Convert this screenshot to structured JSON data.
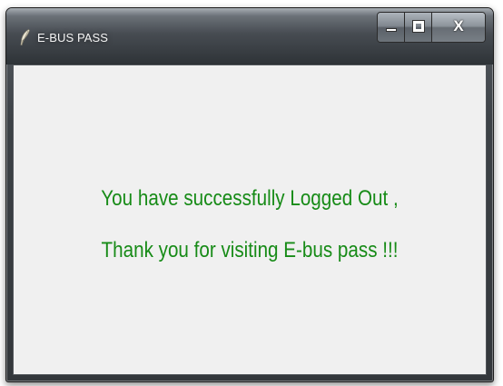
{
  "window": {
    "title": "E-BUS PASS",
    "icon": "feather-icon",
    "controls": {
      "minimize_icon": "minimize-icon",
      "maximize_icon": "maximize-icon",
      "close_label": "X"
    }
  },
  "content": {
    "line1": "You have successfully Logged Out ,",
    "line2": "Thank you for visiting E-bus pass !!!",
    "text_color": "#178b17",
    "background": "#f0f0f0"
  }
}
